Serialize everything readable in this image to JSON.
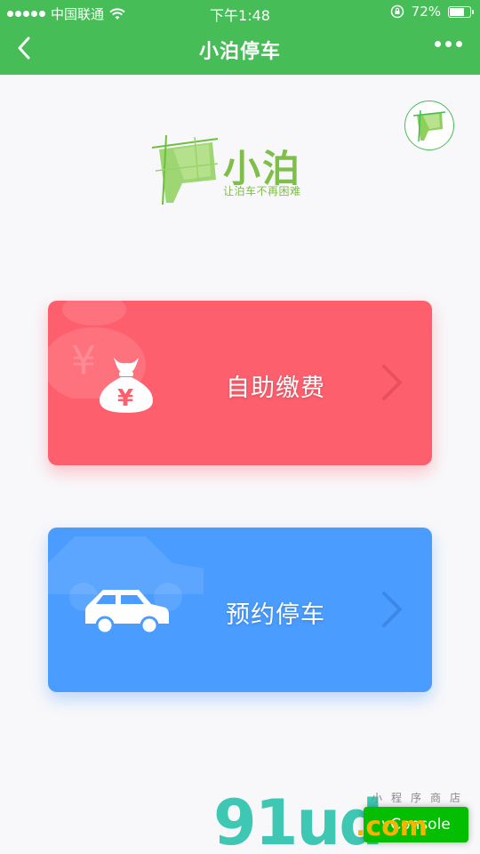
{
  "status_bar": {
    "carrier": "中国联通",
    "time": "下午1:48",
    "battery": "72%",
    "battery_level": 0.72
  },
  "nav": {
    "title": "小泊停车",
    "back_icon": "chevron-left-icon",
    "more_icon": "more-dots-icon"
  },
  "logo": {
    "name": "小泊",
    "slogan": "让泊车不再困难"
  },
  "actions": [
    {
      "label": "自助缴费",
      "icon": "money-bag-icon",
      "color": "#fe5f6d"
    },
    {
      "label": "预约停车",
      "icon": "car-icon",
      "color": "#4a9cff"
    }
  ],
  "watermark": {
    "text": "91ud",
    "suffix": ".com",
    "small": "小程序商店"
  },
  "vconsole": {
    "label": "vConsole",
    "color": "#04be02"
  },
  "colors": {
    "primary": "#46bd57",
    "logo_green": "#7fbe48"
  }
}
